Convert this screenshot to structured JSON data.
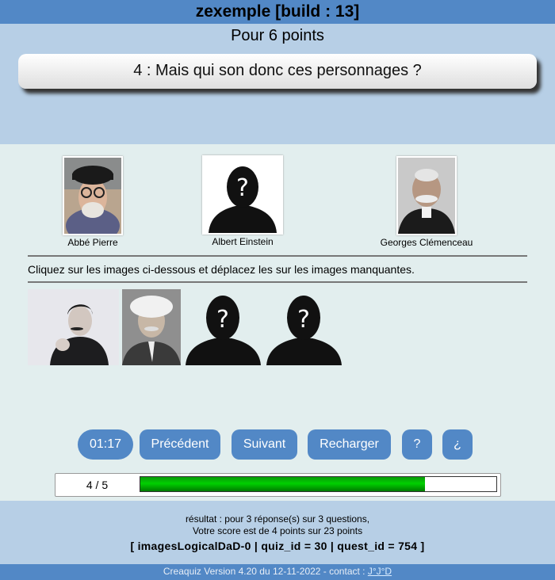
{
  "app": {
    "title": "zexemple [build : 13]"
  },
  "question": {
    "points": "Pour 6 points",
    "text": "4 : Mais qui son donc ces personnages ?"
  },
  "targets": [
    {
      "name": "Abbé Pierre",
      "image": "photo-abbe-pierre"
    },
    {
      "name": "Albert Einstein",
      "image": "unknown-silhouette"
    },
    {
      "name": "Georges Clémenceau",
      "image": "photo-georges-clemenceau"
    }
  ],
  "instruction": "Cliquez sur les images ci-dessous et déplacez les sur les images manquantes.",
  "draggables": [
    {
      "image": "photo-marcel-proust"
    },
    {
      "image": "photo-albert-einstein"
    },
    {
      "image": "unknown-silhouette"
    },
    {
      "image": "unknown-silhouette"
    }
  ],
  "buttons": {
    "timer": "01:17",
    "prev": "Précédent",
    "next": "Suivant",
    "reload": "Recharger",
    "help": "?",
    "inv_help": "¿"
  },
  "progress": {
    "label": "4 / 5",
    "fraction": 0.8
  },
  "result": {
    "line1": "résultat : pour 3 réponse(s) sur 3 questions,",
    "line2": "Votre score est de 4 points sur 23 points",
    "ids": "[ imagesLogicalDaD-0 | quiz_id = 30 | quest_id = 754 ]"
  },
  "footer": {
    "text": "Creaquiz Version 4.20 du 12-11-2022 - contact : ",
    "contact": "J°J°D"
  },
  "colors": {
    "accent": "#5288c6",
    "band": "#b7cfe6",
    "main_bg": "#e2eeee",
    "progress": "#00b400"
  }
}
